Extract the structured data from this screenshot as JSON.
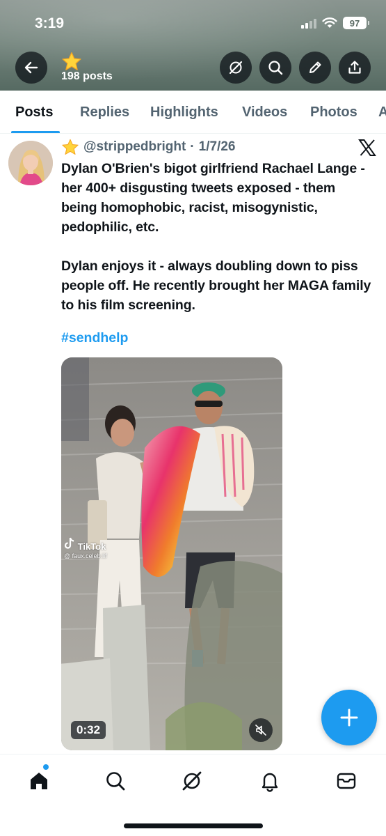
{
  "status_bar": {
    "time": "3:19",
    "battery": "97"
  },
  "header": {
    "post_count": "198 posts",
    "icons": [
      "back-arrow-icon",
      "star-emoji-icon",
      "grok-icon",
      "search-icon",
      "edit-pen-icon",
      "share-icon"
    ]
  },
  "tabs": [
    {
      "label": "Posts",
      "active": true
    },
    {
      "label": "Replies",
      "active": false
    },
    {
      "label": "Highlights",
      "active": false
    },
    {
      "label": "Videos",
      "active": false
    },
    {
      "label": "Photos",
      "active": false
    },
    {
      "label": "A",
      "active": false
    }
  ],
  "post": {
    "handle": "@strippedbright",
    "date": "1/7/26",
    "separator": "·",
    "paragraph_1": "Dylan O'Brien's bigot girlfriend Rachael Lange - her 400+ disgusting tweets exposed - them being homophobic, racist, misogynistic, pedophilic, etc.",
    "paragraph_2": "Dylan enjoys it - always doubling down to piss people off. He recently brought her MAGA family to his film screening.",
    "hashtag": "#sendhelp",
    "video": {
      "watermark": "TikTok",
      "watermark_handle": "@ faux.celeb.lif",
      "duration": "0:32",
      "muted": true
    }
  },
  "bottom_nav": [
    "home-icon",
    "search-icon",
    "grok-icon",
    "bell-icon",
    "mail-icon"
  ],
  "colors": {
    "accent": "#1d9bf0",
    "text": "#0f1419",
    "muted_text": "#536471"
  }
}
